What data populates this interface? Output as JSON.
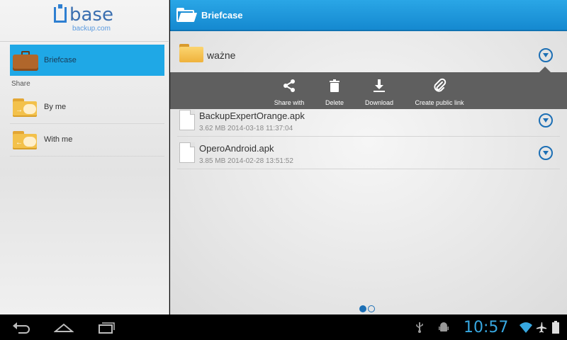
{
  "app": {
    "logo_word": "base",
    "logo_sub": "backup.com"
  },
  "sidebar": {
    "items": [
      {
        "label": "Briefcase",
        "icon": "briefcase-icon",
        "active": true
      },
      {
        "label": "By me",
        "icon": "shared-folder-icon"
      },
      {
        "label": "With me",
        "icon": "shared-folder-icon"
      }
    ],
    "share_header": "Share"
  },
  "header": {
    "title": "Briefcase"
  },
  "folder": {
    "name": "ważne"
  },
  "actions": [
    {
      "label": "Share with",
      "icon": "share-icon"
    },
    {
      "label": "Delete",
      "icon": "trash-icon"
    },
    {
      "label": "Download",
      "icon": "download-icon"
    },
    {
      "label": "Create public link",
      "icon": "paperclip-icon"
    }
  ],
  "files": [
    {
      "name": "BackupExpertOrange.apk",
      "size": "3.62 MB",
      "date": "2014-03-18 11:37:04"
    },
    {
      "name": "OperoAndroid.apk",
      "size": "3.85 MB",
      "date": "2014-02-28 13:51:52"
    }
  ],
  "pager": {
    "pages": 2,
    "current": 1
  },
  "status_bar": {
    "time": "10:57"
  },
  "colors": {
    "accent": "#1fa8e6",
    "header": "#1589d0",
    "icon_blue": "#1c6fb5",
    "action_bar": "#5f5f5f"
  }
}
